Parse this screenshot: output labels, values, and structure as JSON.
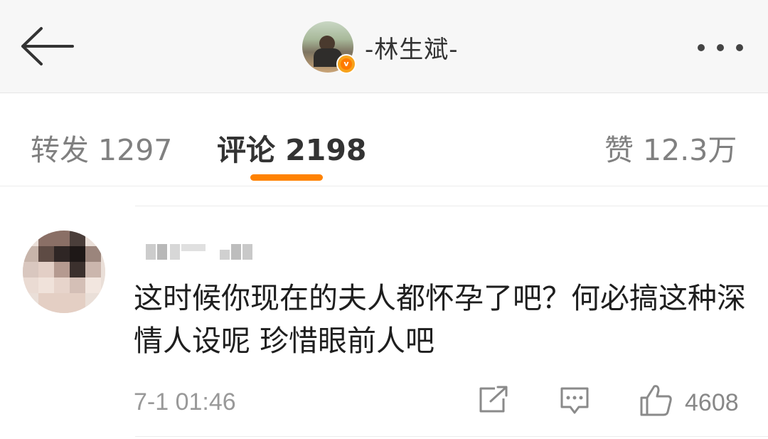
{
  "header": {
    "username": "-林生斌-",
    "verified_badge": "v"
  },
  "tabs": [
    {
      "label": "转发",
      "count": "1297"
    },
    {
      "label": "评论",
      "count": "2198"
    },
    {
      "label": "赞",
      "count": "12.3万"
    }
  ],
  "comment": {
    "text": "这时候你现在的夫人都怀孕了吧？何必搞这种深情人设呢 珍惜眼前人吧",
    "timestamp": "7-1 01:46",
    "like_count": "4608"
  },
  "icons": {
    "back": "arrow-left-icon",
    "more": "more-dots-icon",
    "share": "share-icon",
    "reply": "comment-icon",
    "like": "thumbs-up-icon"
  },
  "colors": {
    "accent": "#ff8200",
    "verified": "#ff7a00",
    "text_primary": "#333333",
    "text_secondary": "#808080",
    "header_bg": "#f7f7f7"
  }
}
